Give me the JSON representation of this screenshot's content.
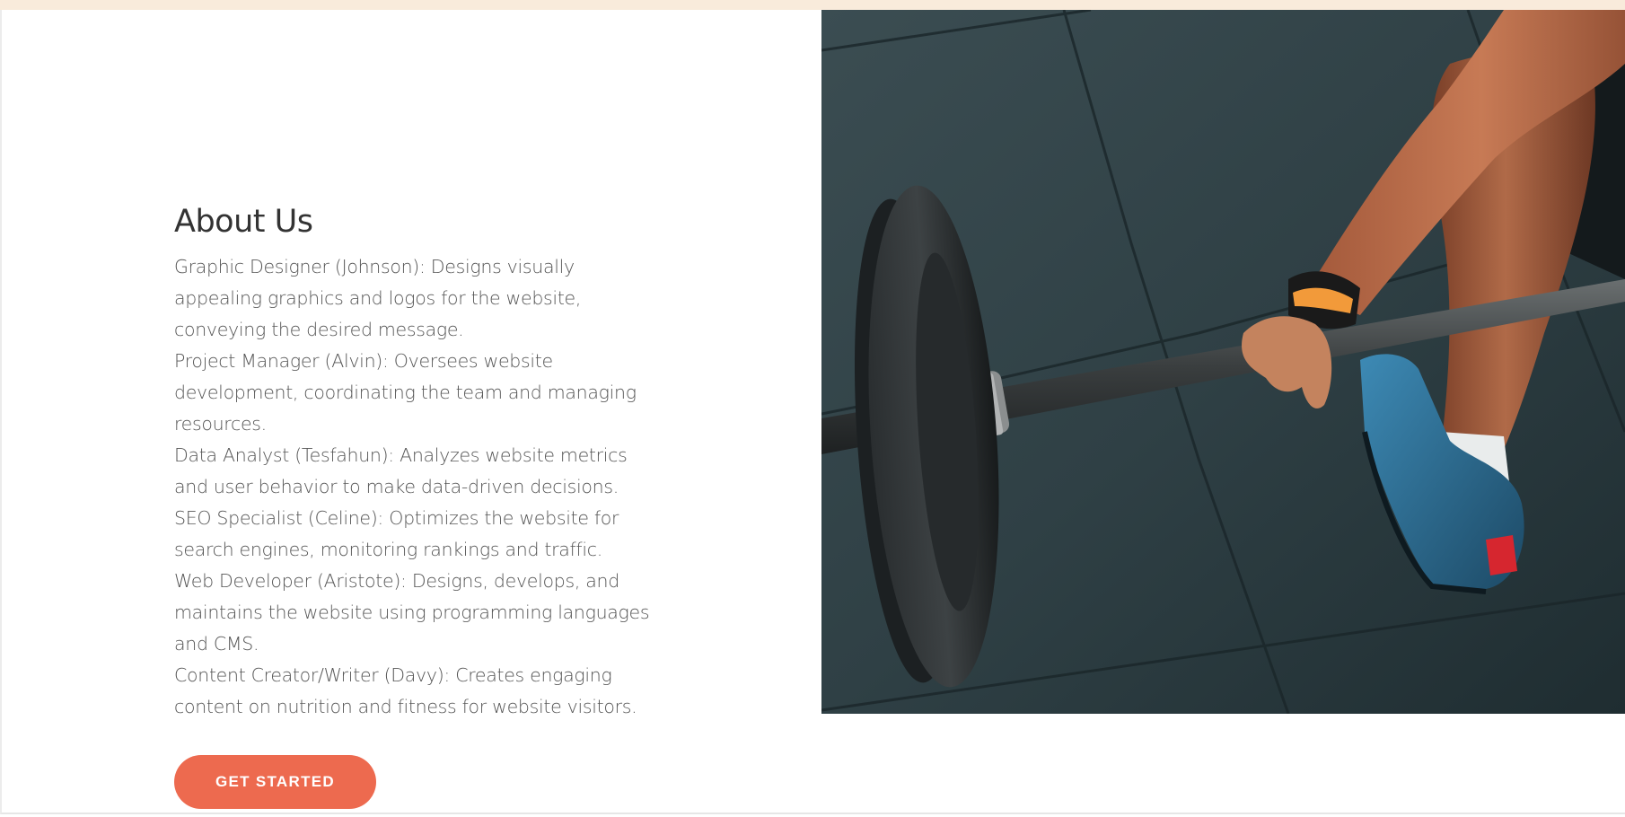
{
  "about": {
    "title": "About Us",
    "paragraphs": [
      "Graphic Designer (Johnson): Designs visually appealing graphics and logos for the website, conveying the desired message.",
      "Project Manager (Alvin): Oversees website development, coordinating the team and managing resources.",
      "Data Analyst (Tesfahun): Analyzes website metrics and user behavior to make data-driven decisions.",
      "SEO Specialist (Celine): Optimizes the website for search engines, monitoring rankings and traffic.",
      "Web Developer (Aristote): Designs, develops, and maintains the website using programming languages and CMS.",
      "Content Creator/Writer (Davy): Creates engaging content on nutrition and fitness for website visitors."
    ]
  },
  "cta": {
    "label": "GET STARTED",
    "color": "#ed6a4f"
  },
  "hero_image": {
    "subject": "barbell-deadlift-photo"
  },
  "colors": {
    "top_band": "#f9ebdb",
    "heading": "#333333",
    "body_text": "#555555"
  }
}
